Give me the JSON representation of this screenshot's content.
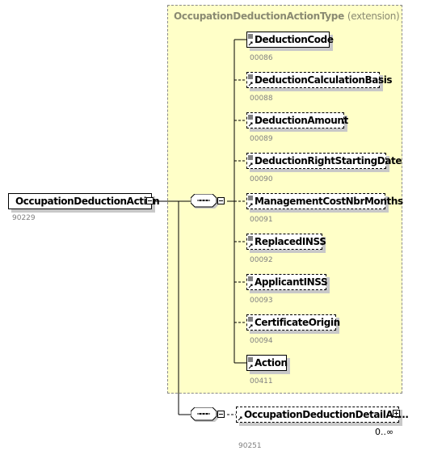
{
  "extension": {
    "type_name": "OccupationDeductionActionType",
    "type_suffix": "(extension)"
  },
  "root": {
    "name": "OccupationDeductionAction",
    "id": "90229"
  },
  "children": [
    {
      "name": "DeductionCode",
      "id": "00086",
      "optional": false
    },
    {
      "name": "DeductionCalculationBasis",
      "id": "00088",
      "optional": true
    },
    {
      "name": "DeductionAmount",
      "id": "00089",
      "optional": true
    },
    {
      "name": "DeductionRightStartingDate",
      "id": "00090",
      "optional": true
    },
    {
      "name": "ManagementCostNbrMonths",
      "id": "00091",
      "optional": true
    },
    {
      "name": "ReplacedINSS",
      "id": "00092",
      "optional": true
    },
    {
      "name": "ApplicantINSS",
      "id": "00093",
      "optional": true
    },
    {
      "name": "CertificateOrigin",
      "id": "00094",
      "optional": true
    },
    {
      "name": "Action",
      "id": "00411",
      "optional": false
    }
  ],
  "detail": {
    "name": "OccupationDeductionDetailAc...",
    "id": "90251",
    "cardinality": "0..∞"
  }
}
